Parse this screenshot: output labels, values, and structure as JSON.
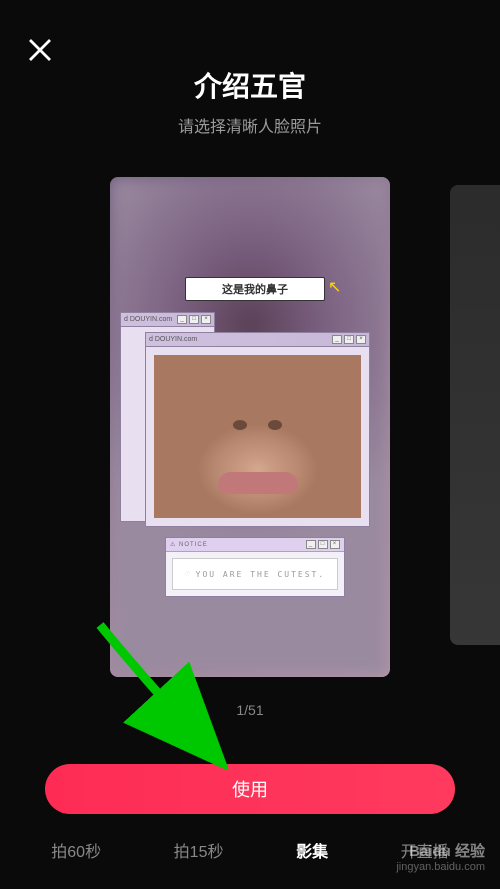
{
  "header": {
    "title": "介绍五官",
    "subtitle": "请选择清晰人脸照片"
  },
  "preview": {
    "speech_text": "这是我的鼻子",
    "window1_title": "d DOUYIN.com",
    "window2_title": "d DOUYIN.com",
    "notice_label": "⚠ NOTICE",
    "cutest_text": "YOU ARE THE CUTEST.",
    "page_indicator": "1/51"
  },
  "actions": {
    "use_button": "使用"
  },
  "tabs": [
    {
      "label": "拍60秒",
      "active": false
    },
    {
      "label": "拍15秒",
      "active": false
    },
    {
      "label": "影集",
      "active": true
    },
    {
      "label": "开直播",
      "active": false
    }
  ],
  "watermark": {
    "brand": "Baidu 经验",
    "url": "jingyan.baidu.com"
  }
}
